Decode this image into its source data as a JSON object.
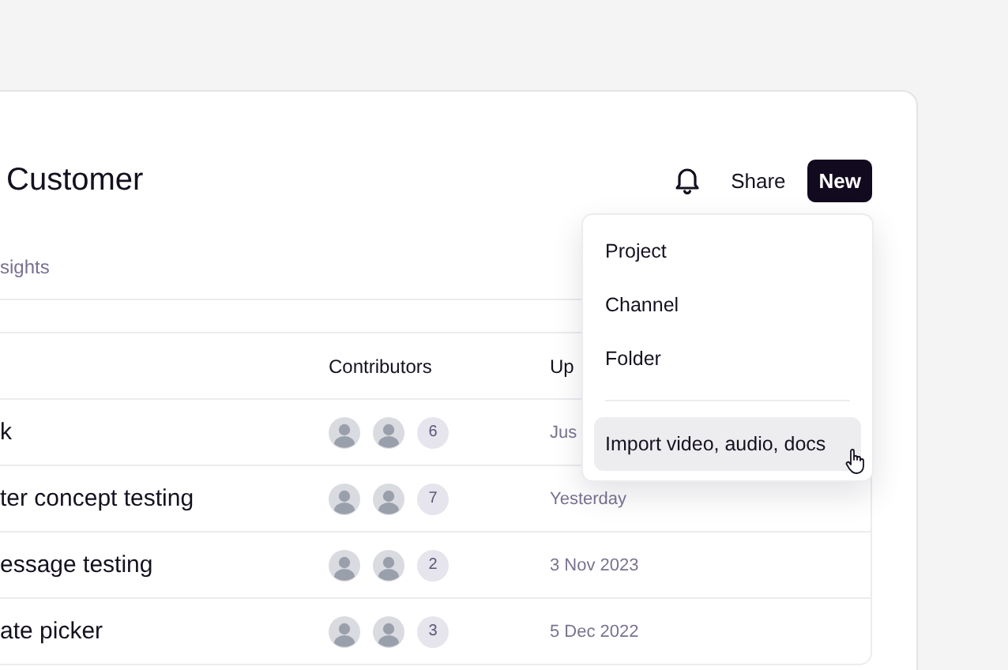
{
  "page": {
    "title": "Customer",
    "actions": {
      "share": "Share",
      "new": "New"
    }
  },
  "tabs": [
    {
      "label": "sights",
      "selected": false
    }
  ],
  "table": {
    "columns": [
      "Contributors",
      "Up"
    ],
    "rows": [
      {
        "name": "k",
        "contributors": "6",
        "updated": "Jus"
      },
      {
        "name": "ter concept testing",
        "contributors": "7",
        "updated": "Yesterday"
      },
      {
        "name": "essage testing",
        "contributors": "2",
        "updated": "3 Nov 2023"
      },
      {
        "name": "ate picker",
        "contributors": "3",
        "updated": "5 Dec 2022"
      }
    ]
  },
  "new_menu": {
    "items": [
      {
        "label": "Project",
        "kind": "item",
        "highlighted": false
      },
      {
        "label": "Channel",
        "kind": "item",
        "highlighted": false
      },
      {
        "label": "Folder",
        "kind": "item",
        "highlighted": false
      },
      {
        "kind": "separator"
      },
      {
        "label": "Import video, audio, docs",
        "kind": "item",
        "highlighted": true
      }
    ]
  }
}
